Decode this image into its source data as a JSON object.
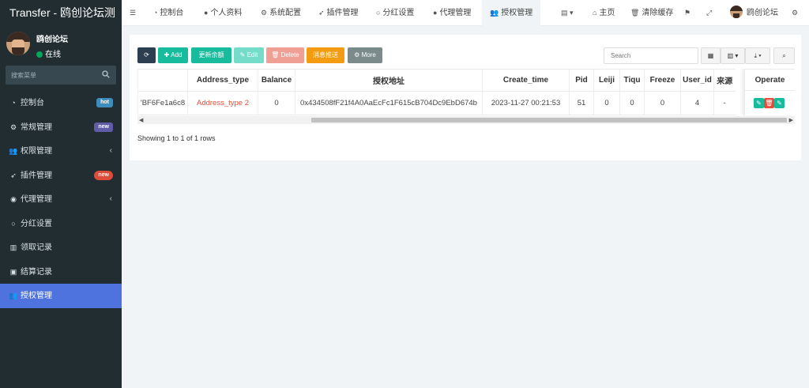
{
  "app": {
    "title": "Transfer - 鸥创论坛测"
  },
  "user": {
    "name": "鸥创论坛",
    "status": "在线"
  },
  "sidebar": {
    "search_placeholder": "搜索菜单",
    "items": [
      {
        "label": "控制台",
        "icon": "dashboard-icon",
        "badge": "hot"
      },
      {
        "label": "常规管理",
        "icon": "cogs-icon",
        "badge": "new"
      },
      {
        "label": "权限管理",
        "icon": "users-icon",
        "chevron": "‹"
      },
      {
        "label": "插件管理",
        "icon": "rocket-icon",
        "badge": "new"
      },
      {
        "label": "代理管理",
        "icon": "user-circle-icon",
        "chevron": "‹"
      },
      {
        "label": "分红设置",
        "icon": "circle-icon"
      },
      {
        "label": "领取记录",
        "icon": "chart-icon"
      },
      {
        "label": "结算记录",
        "icon": "image-icon"
      },
      {
        "label": "授权管理",
        "icon": "users-icon",
        "active": true
      }
    ]
  },
  "topnav": {
    "tabs": [
      {
        "label": "控制台"
      },
      {
        "label": "个人资料"
      },
      {
        "label": "系统配置"
      },
      {
        "label": "插件管理"
      },
      {
        "label": "分红设置"
      },
      {
        "label": "代理管理"
      },
      {
        "label": "授权管理",
        "active": true
      }
    ],
    "home": "主页",
    "clear_cache": "清除缓存",
    "username": "鸥创论坛"
  },
  "toolbar": {
    "add": "Add",
    "update_balance": "更新余额",
    "edit": "Edit",
    "delete": "Delete",
    "push": "消息推送",
    "more": "More",
    "search_placeholder": "Search"
  },
  "table": {
    "columns": [
      "",
      "Address_type",
      "Balance",
      "授权地址",
      "Create_time",
      "Pid",
      "Leiji",
      "Tiqu",
      "Freeze",
      "User_id",
      "来源",
      "Operate"
    ],
    "rows": [
      {
        "col0": "'BF6Fe1a6c8",
        "address_type": "Address_type 2",
        "balance": "0",
        "auth_address": "0x434508fF21f4A0AaEcFc1F615cB704Dc9EbD674b",
        "create_time": "2023-11-27 00:21:53",
        "pid": "51",
        "leiji": "0",
        "tiqu": "0",
        "freeze": "0",
        "user_id": "4",
        "source": "-"
      }
    ]
  },
  "pagination": {
    "info": "Showing 1 to 1 of 1 rows"
  },
  "colors": {
    "sidebar_bg": "#222d32",
    "accent": "#4e73df",
    "success": "#18bc9c",
    "danger": "#e74c3c",
    "warning": "#f39c12"
  }
}
